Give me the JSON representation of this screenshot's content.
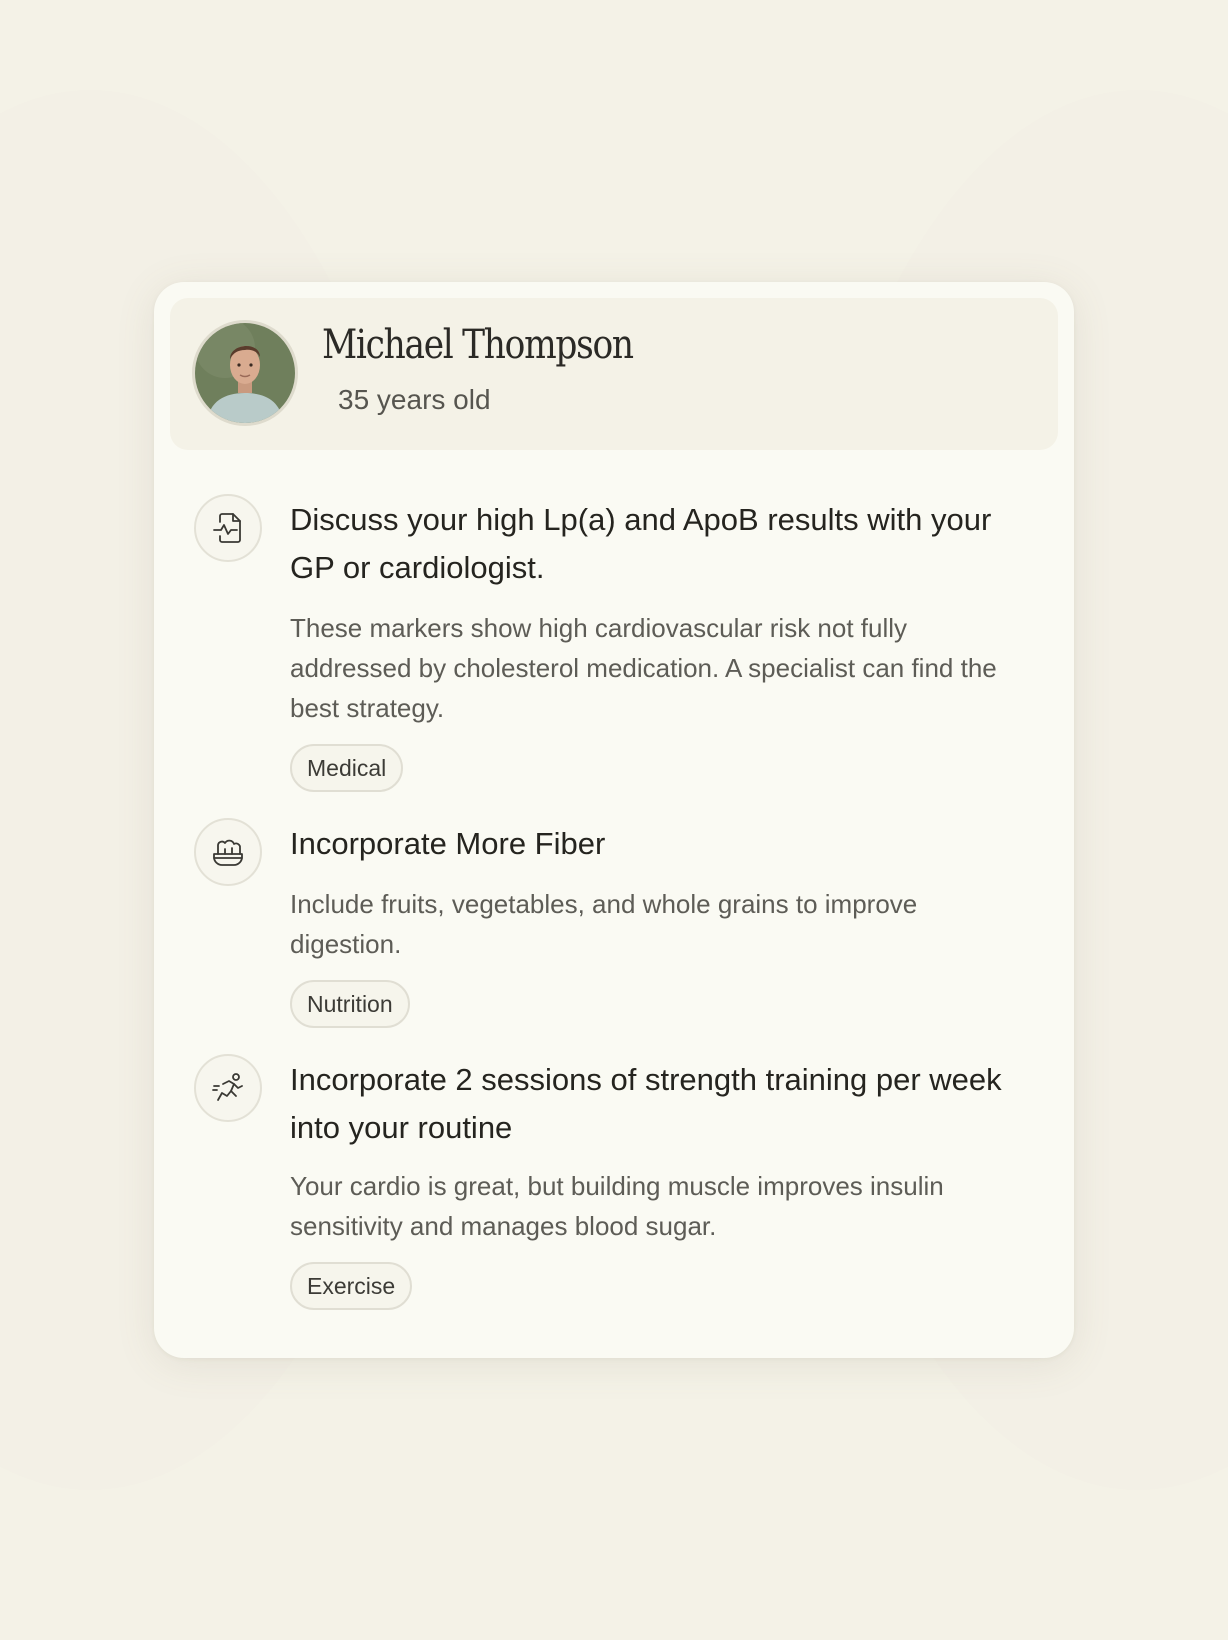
{
  "profile": {
    "name": "Michael Thompson",
    "age": "35 years old"
  },
  "recommendations": [
    {
      "icon": "heart-monitor-document-icon",
      "title": "Discuss your high Lp(a) and ApoB results with your GP or cardiologist.",
      "description": "These markers show high cardiovascular risk not fully addressed by cholesterol medication. A specialist can find the best strategy.",
      "tag": "Medical"
    },
    {
      "icon": "salad-bowl-icon",
      "title": "Incorporate More Fiber",
      "description": "Include fruits, vegetables, and whole grains to improve digestion.",
      "tag": "Nutrition"
    },
    {
      "icon": "running-person-icon",
      "title": "Incorporate 2 sessions of strength training per week into your routine",
      "description": "Your cardio is great, but building muscle improves insulin sensitivity and manages blood sugar.",
      "tag": "Exercise"
    }
  ]
}
